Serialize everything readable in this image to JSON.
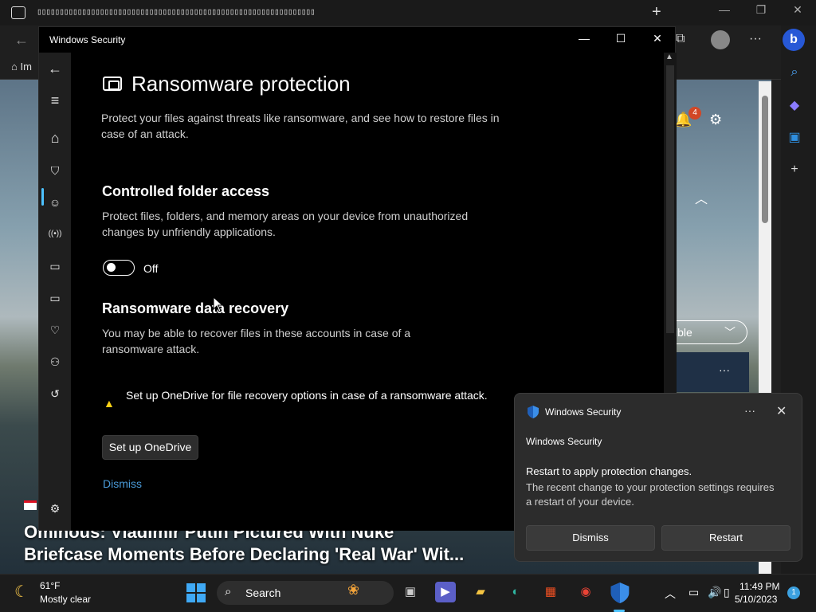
{
  "browser": {
    "tab_strip_glyph": "▯▯▯▯▯▯▯▯▯▯▯▯▯▯▯▯▯▯▯▯▯▯▯▯▯▯▯▯▯▯▯▯▯▯▯▯▯▯▯▯▯▯▯▯▯▯▯▯▯▯▯▯▯▯▯▯▯▯▯▯▯▯",
    "new_tab": "+",
    "minimize": "—",
    "restore": "❐",
    "close": "✕",
    "back": "←",
    "fav_item": "Im",
    "notification_count": "4",
    "filter_pill": "ible",
    "news_headline_line1": "Ominous: Vladimir Putin Pictured With Nuke",
    "news_headline_line2": "Briefcase Moments Before Declaring 'Real War' Wit..."
  },
  "window": {
    "title": "Windows Security",
    "minimize": "—",
    "maximize": "☐",
    "close": "✕"
  },
  "nav": {
    "back": "←",
    "menu": "≡",
    "home": "⌂",
    "virus": "⛉",
    "account": "☺",
    "firewall": "((•))",
    "app_browser": "▭",
    "device_security": "▭",
    "performance": "♡",
    "family": "⚇",
    "history": "↺",
    "settings": "⚙"
  },
  "page": {
    "title": "Ransomware protection",
    "description": "Protect your files against threats like ransomware, and see how to restore files in case of an attack.",
    "cfa": {
      "title": "Controlled folder access",
      "description": "Protect files, folders, and memory areas on your device from unauthorized changes by unfriendly applications.",
      "toggle_state": "Off"
    },
    "recovery": {
      "title": "Ransomware data recovery",
      "description": "You may be able to recover files in these accounts in case of a ransomware attack.",
      "warning": "Set up OneDrive for file recovery options in case of a ransomware attack.",
      "setup_button": "Set up OneDrive",
      "dismiss_link": "Dismiss"
    }
  },
  "toast": {
    "app_name": "Windows Security",
    "more": "···",
    "close": "✕",
    "source": "Windows Security",
    "heading": "Restart to apply protection changes.",
    "body": "The recent change to your protection settings requires a restart of your device.",
    "dismiss": "Dismiss",
    "restart": "Restart"
  },
  "taskbar": {
    "temperature": "61°F",
    "weather": "Mostly clear",
    "search": "Search",
    "time": "11:49 PM",
    "date": "5/10/2023",
    "notification_count": "1"
  },
  "colors": {
    "accent": "#4cc2ff",
    "link": "#4a9bd9",
    "warning": "#fcd116"
  }
}
